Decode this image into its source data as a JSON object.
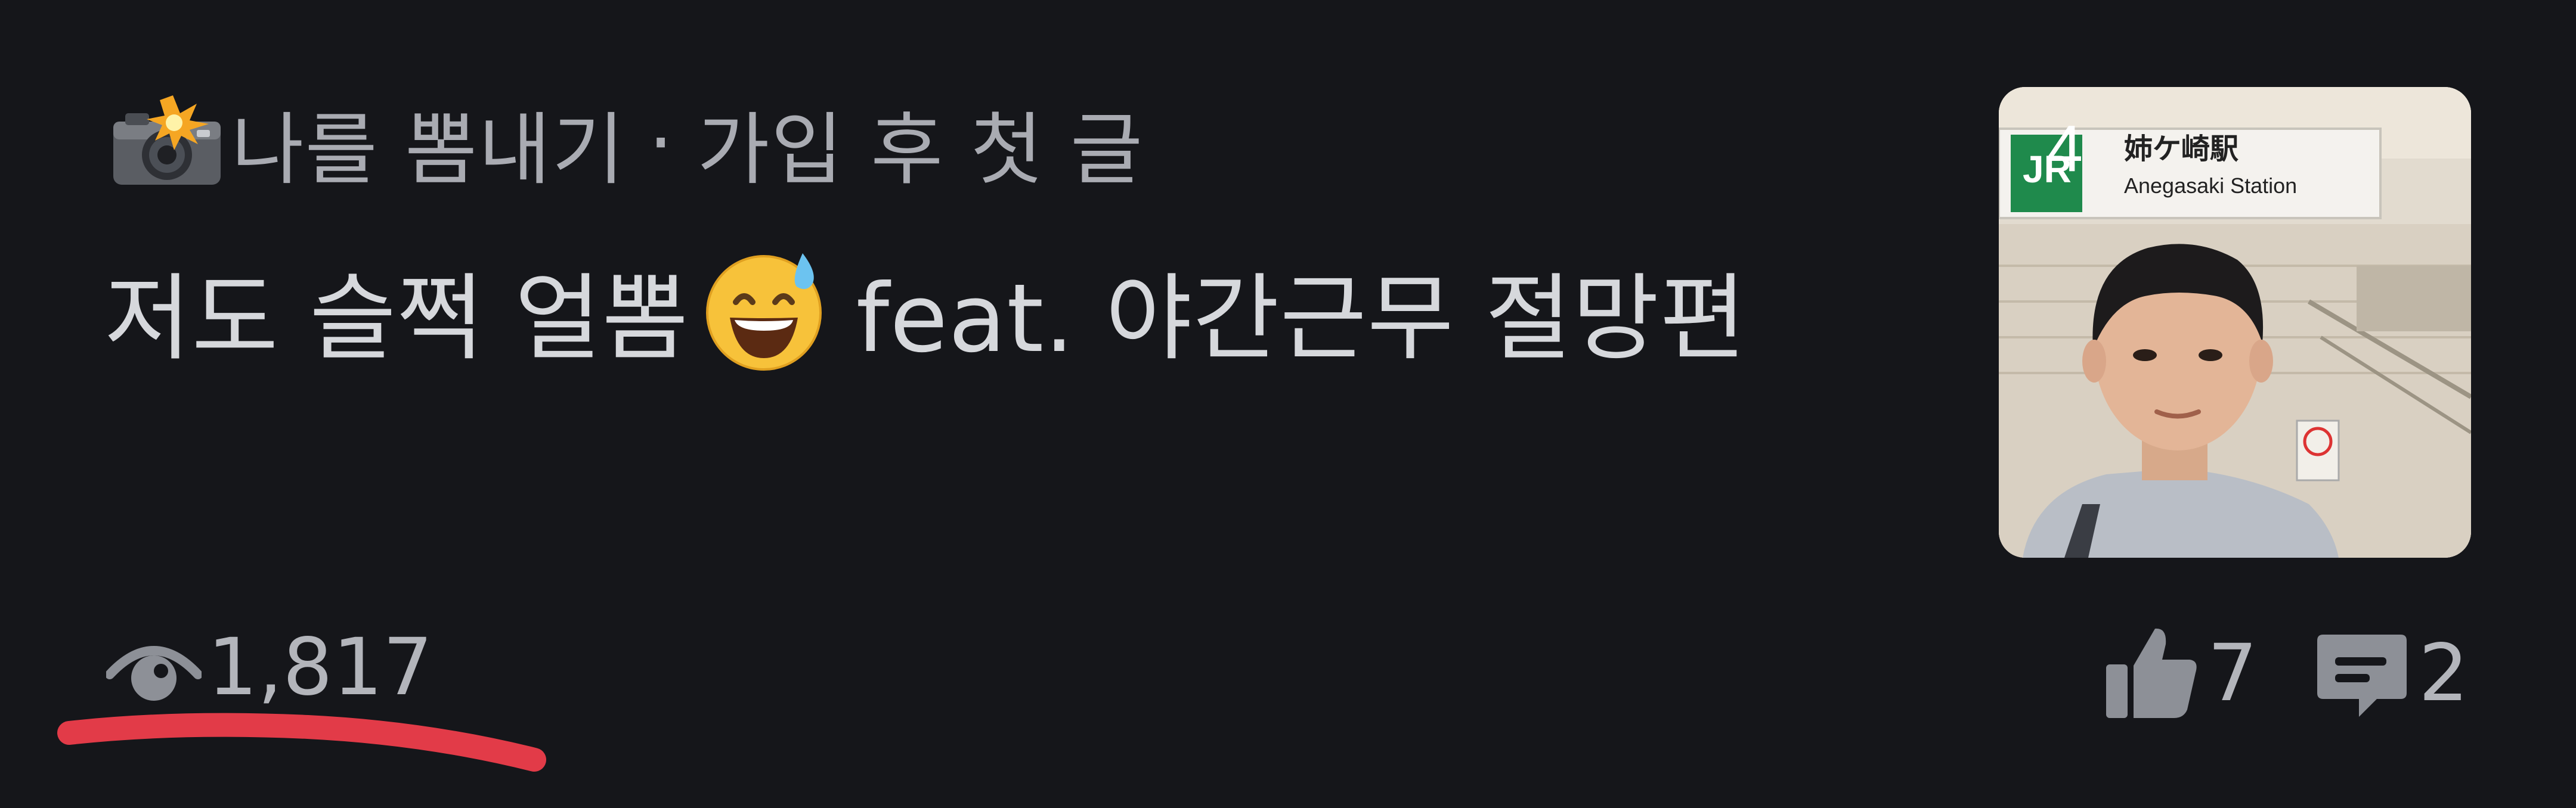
{
  "post": {
    "category": "나를 뽐내기",
    "separator": "·",
    "tag": "가입 후 첫 글",
    "title_part1": "저도 슬쩍 얼뽐",
    "title_part2": "feat. 야간근무 절망편",
    "thumbnail_count": "4",
    "thumbnail_sign_text": "姉ケ崎駅",
    "thumbnail_sign_sub": "Anegasaki Station",
    "views": "1,817",
    "likes": "7",
    "comments": "2"
  },
  "icons": {
    "category": "camera-flash-icon",
    "title_emoji": "grinning-sweat-emoji",
    "views": "eye-icon",
    "likes": "thumbs-up-icon",
    "comments": "comment-icon"
  },
  "colors": {
    "background": "#15161a",
    "text_primary": "#d6d8dc",
    "text_secondary": "#a9abb2",
    "annotation": "#e23b48"
  }
}
